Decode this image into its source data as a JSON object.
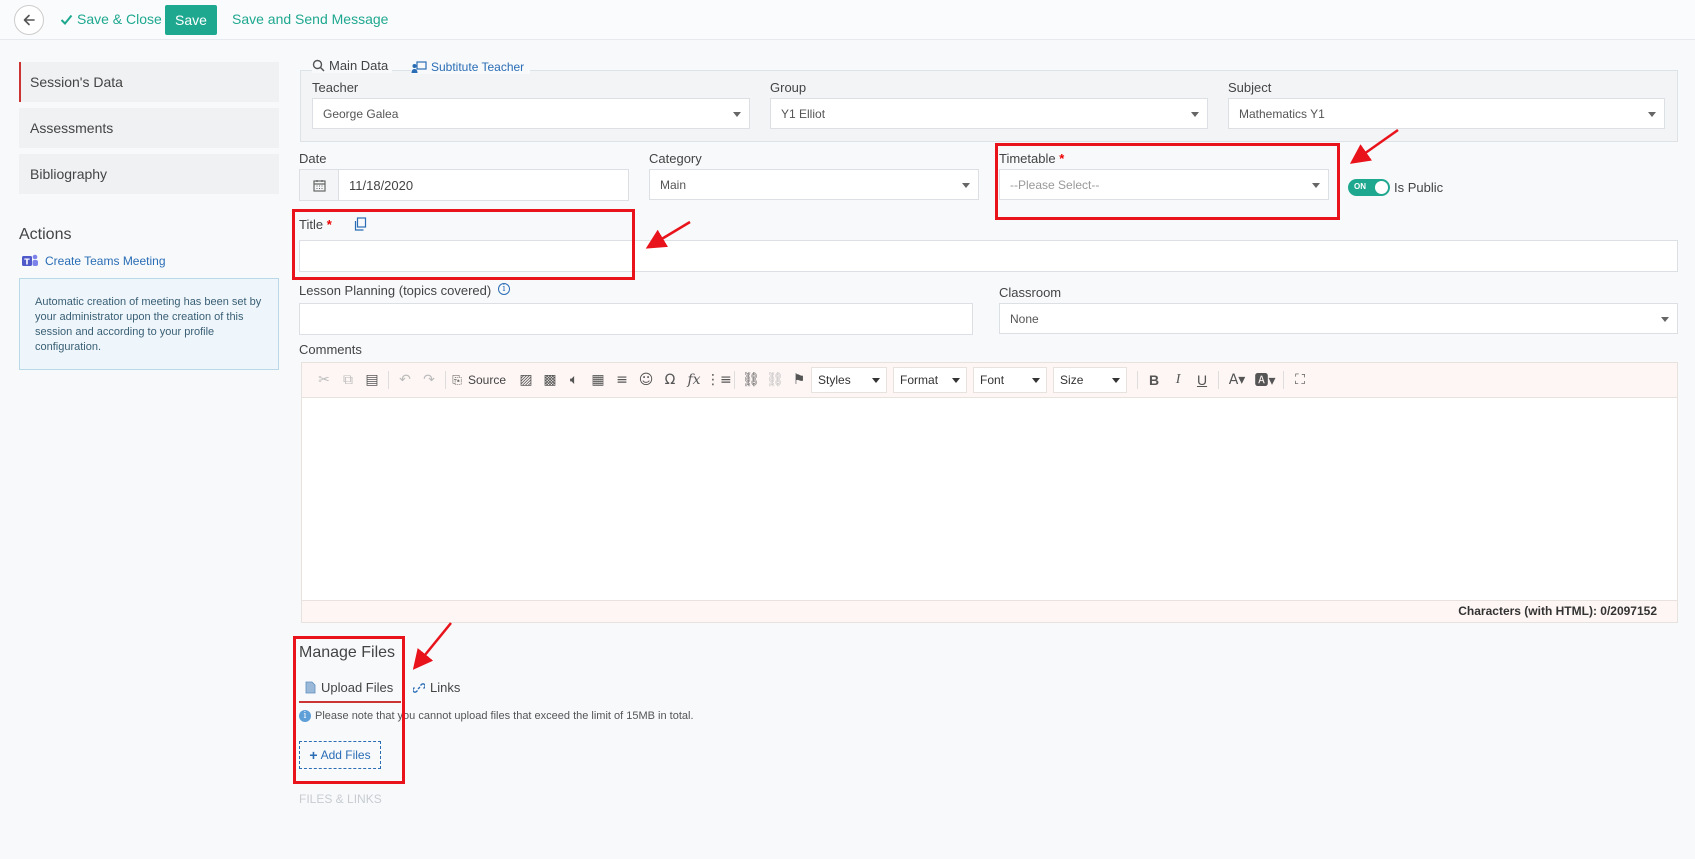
{
  "toolbar": {
    "save_close": "Save & Close",
    "save": "Save",
    "save_send": "Save and Send Message"
  },
  "sidebar": {
    "items": [
      {
        "label": "Session's Data"
      },
      {
        "label": "Assessments"
      },
      {
        "label": "Bibliography"
      }
    ],
    "actions_title": "Actions",
    "create_teams": "Create Teams Meeting",
    "info_text": "Automatic creation of meeting has been set by your administrator upon the creation of this session and according to your profile configuration."
  },
  "main_tabs": {
    "main_data": "Main Data",
    "substitute": "Subtitute Teacher"
  },
  "form": {
    "teacher_label": "Teacher",
    "teacher_value": "George Galea",
    "group_label": "Group",
    "group_value": "Y1 Elliot",
    "subject_label": "Subject",
    "subject_value": "Mathematics Y1",
    "date_label": "Date",
    "date_value": "11/18/2020",
    "category_label": "Category",
    "category_value": "Main",
    "timetable_label": "Timetable",
    "timetable_value": "--Please Select--",
    "required_mark": "*",
    "toggle_on": "ON",
    "is_public": "Is Public",
    "title_label": "Title",
    "title_value": "",
    "lesson_label": "Lesson Planning (topics covered)",
    "lesson_value": "",
    "classroom_label": "Classroom",
    "classroom_value": "None",
    "comments_label": "Comments"
  },
  "editor": {
    "source": "Source",
    "styles": "Styles",
    "format": "Format",
    "font": "Font",
    "size": "Size",
    "char_count": "Characters (with HTML): 0/2097152"
  },
  "files": {
    "title": "Manage Files",
    "upload_tab": "Upload Files",
    "links_tab": "Links",
    "note": "Please note that you cannot upload files that exceed the limit of 15MB in total.",
    "add_files": "Add Files",
    "files_links_header": "FILES & LINKS"
  },
  "colors": {
    "accent": "#1fa890",
    "highlight": "#e8131b",
    "link": "#2a6db5"
  }
}
